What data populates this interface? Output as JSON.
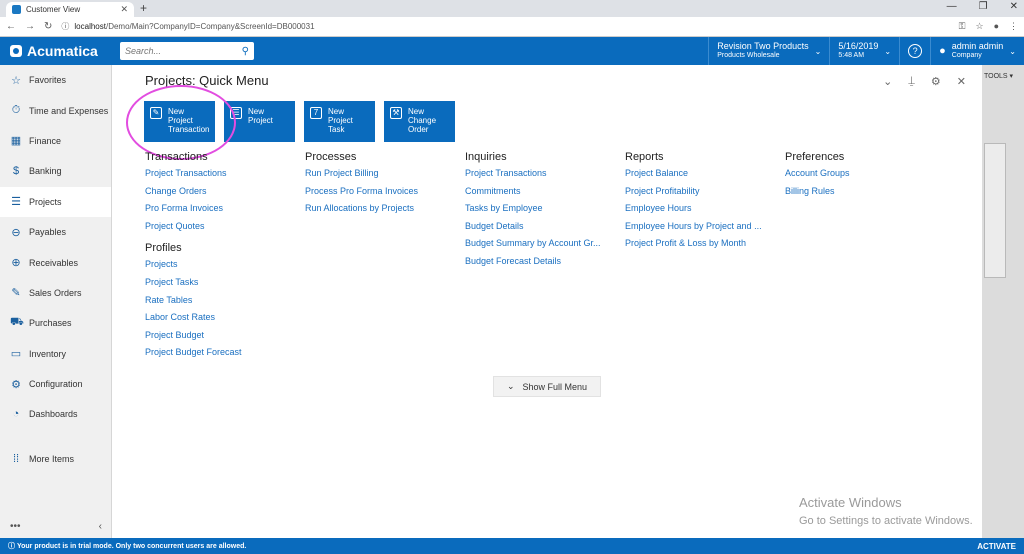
{
  "browser": {
    "tab_title": "Customer View",
    "url_host": "localhost",
    "url_path": "/Demo/Main?CompanyID=Company&ScreenId=DB000031"
  },
  "header": {
    "logo": "Acumatica",
    "search_placeholder": "Search...",
    "branch_line1": "Revision Two Products",
    "branch_line2": "Products Wholesale",
    "date": "5/16/2019",
    "time": "5:48 AM",
    "user_name": "admin admin",
    "company": "Company"
  },
  "sidebar": {
    "items": [
      {
        "label": "Favorites",
        "icon": "star-icon"
      },
      {
        "label": "Time and Expenses",
        "icon": "clock-icon"
      },
      {
        "label": "Finance",
        "icon": "calculator-icon"
      },
      {
        "label": "Banking",
        "icon": "dollar-icon"
      },
      {
        "label": "Projects",
        "icon": "projects-icon"
      },
      {
        "label": "Payables",
        "icon": "minus-circle-icon"
      },
      {
        "label": "Receivables",
        "icon": "plus-circle-icon"
      },
      {
        "label": "Sales Orders",
        "icon": "edit-icon"
      },
      {
        "label": "Purchases",
        "icon": "cart-icon"
      },
      {
        "label": "Inventory",
        "icon": "truck-icon"
      },
      {
        "label": "Configuration",
        "icon": "gear-icon"
      },
      {
        "label": "Dashboards",
        "icon": "gauge-icon"
      }
    ],
    "more": "More Items",
    "active": "Projects"
  },
  "background": {
    "tools_label": "TOOLS"
  },
  "quick_menu": {
    "title": "Projects: Quick Menu",
    "tiles": [
      [
        "New",
        "Project",
        "Transaction"
      ],
      [
        "New",
        "Project"
      ],
      [
        "New",
        "Project",
        "Task"
      ],
      [
        "New",
        "Change",
        "Order"
      ]
    ],
    "columns": [
      {
        "heading": "Transactions",
        "links": [
          "Project Transactions",
          "Change Orders",
          "Pro Forma Invoices",
          "Project Quotes"
        ],
        "sub_heading": "Profiles",
        "sub_links": [
          "Projects",
          "Project Tasks",
          "Rate Tables",
          "Labor Cost Rates",
          "Project Budget",
          "Project Budget Forecast"
        ]
      },
      {
        "heading": "Processes",
        "links": [
          "Run Project Billing",
          "Process Pro Forma Invoices",
          "Run Allocations by Projects"
        ]
      },
      {
        "heading": "Inquiries",
        "links": [
          "Project Transactions",
          "Commitments",
          "Tasks by Employee",
          "Budget Details",
          "Budget Summary by Account Gr...",
          "Budget Forecast Details"
        ]
      },
      {
        "heading": "Reports",
        "links": [
          "Project Balance",
          "Project Profitability",
          "Employee Hours",
          "Employee Hours by Project and ...",
          "Project Profit & Loss by Month"
        ]
      },
      {
        "heading": "Preferences",
        "links": [
          "Account Groups",
          "Billing Rules"
        ]
      }
    ],
    "full_menu": "Show Full Menu"
  },
  "watermark": {
    "line1": "Activate Windows",
    "line2": "Go to Settings to activate Windows."
  },
  "status": {
    "message": "Your product is in trial mode. Only two concurrent users are allowed.",
    "action": "ACTIVATE"
  }
}
